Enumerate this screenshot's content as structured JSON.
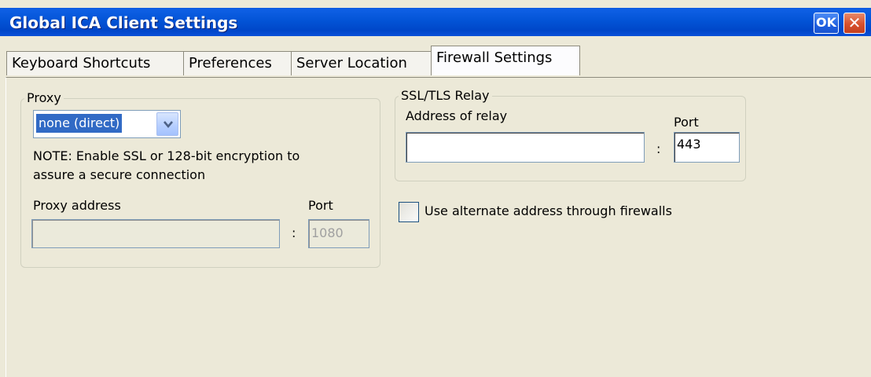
{
  "window": {
    "title": "Global ICA Client Settings",
    "ok_label": "OK",
    "close_glyph": "✕"
  },
  "tabs": [
    {
      "label": "Keyboard Shortcuts",
      "active": false
    },
    {
      "label": "Preferences",
      "active": false
    },
    {
      "label": "Server Location",
      "active": false
    },
    {
      "label": "Firewall Settings",
      "active": true
    }
  ],
  "proxy": {
    "legend": "Proxy",
    "type_selected": "none (direct)",
    "note_line1": "NOTE: Enable SSL or 128-bit encryption to",
    "note_line2": "assure a secure connection",
    "address_label": "Proxy address",
    "address_value": "",
    "port_label": "Port",
    "port_separator": ":",
    "port_value": "1080"
  },
  "ssl_relay": {
    "legend": "SSL/TLS Relay",
    "address_label": "Address of relay",
    "address_value": "",
    "port_label": "Port",
    "port_separator": ":",
    "port_value": "443"
  },
  "alternate_address": {
    "label": "Use alternate address through firewalls",
    "checked": false
  },
  "icons": {
    "dropdown": "chevron-down-icon"
  },
  "colors": {
    "titlebar": "#0354d6",
    "selection": "#316ac5",
    "close_button": "#d8512d",
    "dialog_bg": "#ece9d8"
  }
}
